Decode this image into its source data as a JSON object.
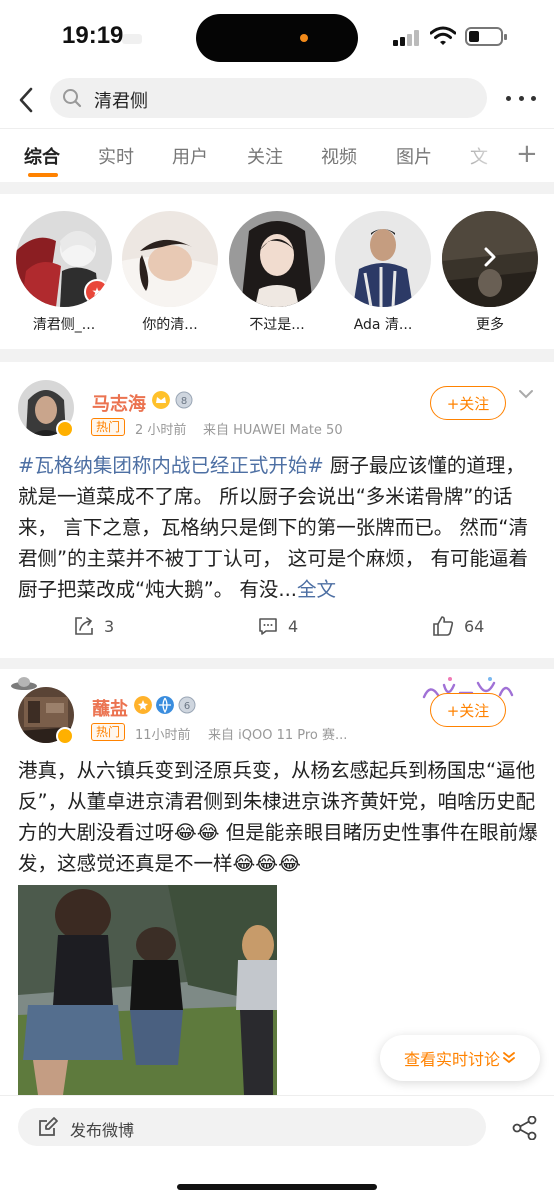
{
  "status_bar": {
    "time": "19:19"
  },
  "search": {
    "query": "清君侧"
  },
  "tabs": [
    {
      "label": "综合",
      "active": true
    },
    {
      "label": "实时",
      "active": false
    },
    {
      "label": "用户",
      "active": false
    },
    {
      "label": "关注",
      "active": false
    },
    {
      "label": "视频",
      "active": false
    },
    {
      "label": "图片",
      "active": false
    },
    {
      "label": "文",
      "active": false
    }
  ],
  "users": [
    {
      "name": "清君侧_..."
    },
    {
      "name": "你的清..."
    },
    {
      "name": "不过是..."
    },
    {
      "name": "Ada 清..."
    },
    {
      "name": "更多"
    }
  ],
  "posts": [
    {
      "author": "马志海",
      "hot_label": "热门",
      "time": "2 小时前",
      "source": "来自 HUAWEI Mate 50",
      "follow_label": "+关注",
      "topic": "#瓦格纳集团称内战已经正式开始#",
      "text": " 厨子最应该懂的道理， 就是一道菜成不了席。 所以厨子会说出“多米诺骨牌”的话来， 言下之意，瓦格纳只是倒下的第一张牌而已。 然而“清君侧”的主菜并不被丁丁认可， 这可是个麻烦， 有可能逼着厨子把菜改成“炖大鹅”。 有没...",
      "more_link": "全文",
      "reposts": "3",
      "comments": "4",
      "likes": "64"
    },
    {
      "author": "蘸盐",
      "hot_label": "热门",
      "time": "11小时前",
      "source": "来自 iQOO 11 Pro 赛...",
      "follow_label": "+关注",
      "text": "港真，从六镇兵变到泾原兵变，从杨玄感起兵到杨国忠“逼他反”，从董卓进京清君侧到朱棣进京诛齐黄奸党，咱啥历史配方的大剧没看过呀😂😂 但是能亲眼目睹历史性事件在眼前爆发，这感觉还真是不一样😂😂😂"
    }
  ],
  "discuss_button": "查看实时讨论",
  "compose": {
    "placeholder": "发布微博"
  },
  "colors": {
    "accent": "#ff8200",
    "link": "#4d6fa3",
    "name": "#eb7350"
  }
}
